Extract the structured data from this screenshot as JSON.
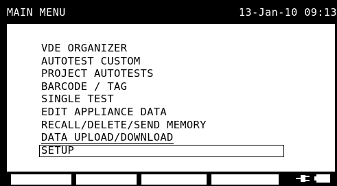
{
  "header": {
    "title": "MAIN MENU",
    "datetime": "13-Jan-10 09:13"
  },
  "menu": {
    "items": [
      "VDE ORGANIZER",
      "AUTOTEST CUSTOM",
      "PROJECT AUTOTESTS",
      "BARCODE / TAG",
      "SINGLE TEST",
      "EDIT APPLIANCE DATA",
      "RECALL/DELETE/SEND MEMORY",
      "DATA UPLOAD/DOWNLOAD",
      "SETUP"
    ],
    "selected": "SETUP"
  },
  "footer": {
    "icons": [
      "mains-plug-icon",
      "battery-icon"
    ]
  },
  "colors": {
    "background": "#000000",
    "panel": "#ffffff",
    "text": "#000000"
  }
}
